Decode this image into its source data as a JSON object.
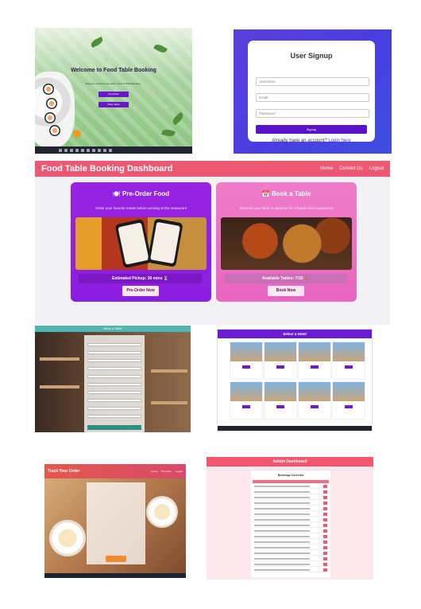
{
  "welcome": {
    "title": "Welcome to Food Table Booking",
    "subtitle": "Enjoy an exclusive pre-order menu & Table Booking",
    "button_1": "Pre-Order",
    "button_2": "Book Table"
  },
  "signup": {
    "title": "User Signup",
    "username_placeholder": "Username",
    "email_placeholder": "Email",
    "password_placeholder": "Password",
    "submit_label": "Signup",
    "footer_text": "Already have an account?",
    "login_link": "Login here"
  },
  "dashboard": {
    "brand": "Food Table Booking Dashboard",
    "nav": [
      "Home",
      "Contact Us",
      "Logout"
    ],
    "preorder": {
      "title": "Pre-Order Food",
      "icon": "🍽️",
      "description": "Order your favorite meals before arriving at the restaurant",
      "status": "Estimated Pickup: 30 mins ⏳",
      "button": "Pre-Order Now"
    },
    "booktable": {
      "title": "Book a Table",
      "icon": "📅",
      "description": "Reserve your table in advance for a hassle-free experience",
      "status": "Available Tables: 7/10 🪑",
      "button": "Book Now"
    }
  },
  "book_table_page": {
    "header": "Book a Table"
  },
  "hotel_page": {
    "header": "Select a Hotel"
  },
  "track_order": {
    "brand": "Track Your Order",
    "nav": [
      "Home",
      "Pre-order",
      "Logout"
    ]
  },
  "admin": {
    "header": "Admin Dashboard",
    "section_title": "Bookings Overview"
  },
  "colors": {
    "dashboard_nav": "#ee5872",
    "preorder_card": "#9823e2",
    "booktable_card": "#ef7cc9",
    "signup_button": "#5813c9"
  }
}
